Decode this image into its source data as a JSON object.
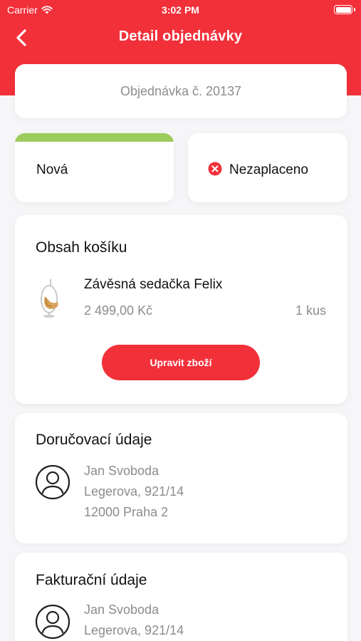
{
  "status_bar": {
    "carrier": "Carrier",
    "time": "3:02 PM"
  },
  "nav": {
    "title": "Detail objednávky",
    "back_icon": "chevron-left-icon"
  },
  "order": {
    "number_label": "Objednávka č. 20137"
  },
  "order_status": {
    "label": "Nová",
    "color": "#9ccc5c"
  },
  "payment_status": {
    "label": "Nezaplaceno",
    "icon": "x-circle-icon",
    "color": "#f2303a"
  },
  "cart": {
    "title": "Obsah košíku",
    "items": [
      {
        "name": "Závěsná sedačka Felix",
        "price": "2 499,00 Kč",
        "quantity": "1 kus",
        "image_icon": "hanging-chair-image"
      }
    ],
    "edit_button": "Upravit zboží"
  },
  "delivery": {
    "title": "Doručovací údaje",
    "name": "Jan Svoboda",
    "street": "Legerova, 921/14",
    "city": "12000 Praha 2"
  },
  "billing": {
    "title": "Fakturační údaje",
    "name": "Jan Svoboda",
    "street": "Legerova, 921/14"
  },
  "colors": {
    "accent": "#f2303a",
    "background": "#f6f6f8",
    "muted_text": "#8c8c8c"
  }
}
